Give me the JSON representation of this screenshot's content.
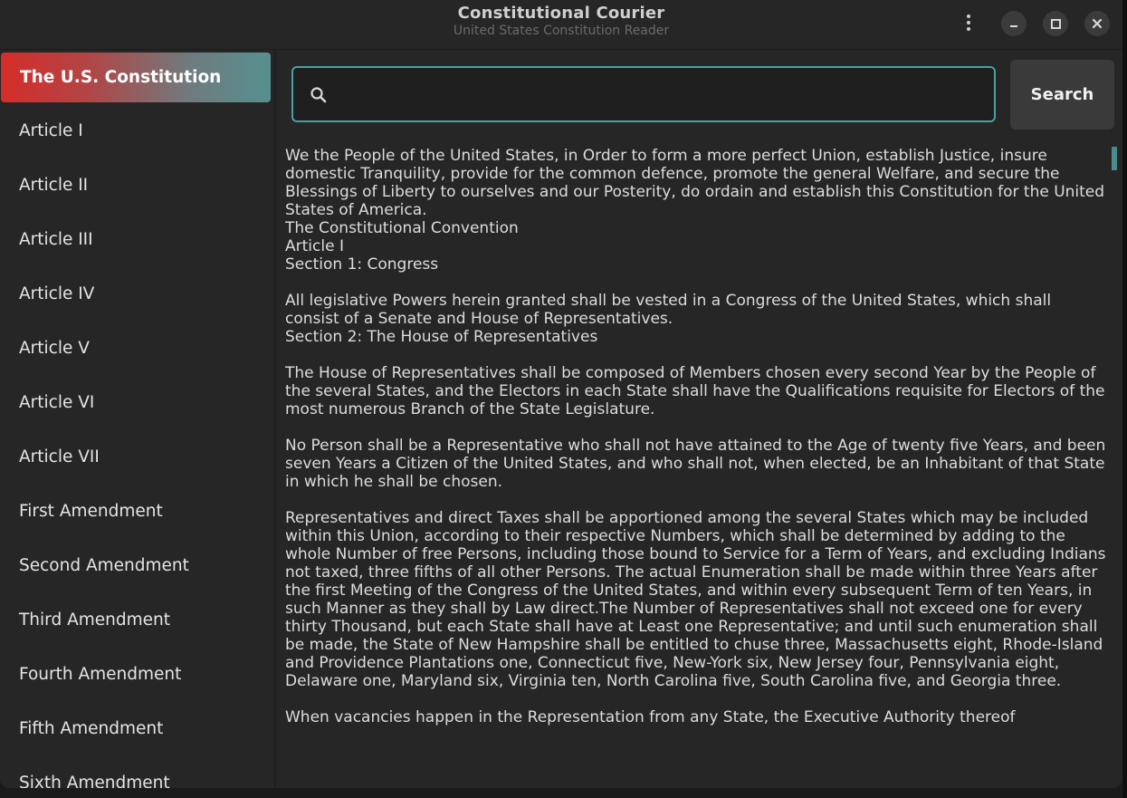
{
  "window": {
    "title": "Constitutional Courier",
    "subtitle": "United States Constitution Reader"
  },
  "titlebar_controls": [
    "menu-icon",
    "minimize-icon",
    "maximize-icon",
    "close-icon"
  ],
  "sidebar": {
    "items": [
      {
        "label": "The U.S. Constitution",
        "active": true
      },
      {
        "label": "Article I"
      },
      {
        "label": "Article II"
      },
      {
        "label": "Article III"
      },
      {
        "label": "Article IV"
      },
      {
        "label": "Article V"
      },
      {
        "label": "Article VI"
      },
      {
        "label": "Article VII"
      },
      {
        "label": "First Amendment"
      },
      {
        "label": "Second Amendment"
      },
      {
        "label": "Third Amendment"
      },
      {
        "label": "Fourth Amendment"
      },
      {
        "label": "Fifth Amendment"
      },
      {
        "label": "Sixth Amendment"
      }
    ]
  },
  "search": {
    "value": "",
    "placeholder": "",
    "button_label": "Search"
  },
  "content": {
    "preamble": "We the People of the United States, in Order to form a more perfect Union, establish Justice, insure domestic Tranquility, provide for the common defence, promote the general Welfare, and secure the Blessings of Liberty to ourselves and our Posterity, do ordain and establish this Constitution for the United States of America.",
    "convention": "The Constitutional Convention",
    "article": "Article I",
    "section1_title": "Section 1: Congress",
    "section1_text": "All legislative Powers herein granted shall be vested in a Congress of the United States, which shall consist of a Senate and House of Representatives.",
    "section2_title": "Section 2: The House of Representatives",
    "section2_p1": "The House of Representatives shall be composed of Members chosen every second Year by the People of the several States, and the Electors in each State shall have the Qualifications requisite for Electors of the most numerous Branch of the State Legislature.",
    "section2_p2": "No Person shall be a Representative who shall not have attained to the Age of twenty five Years, and been seven Years a Citizen of the United States, and who shall not, when elected, be an Inhabitant of that State in which he shall be chosen.",
    "section2_p3": "Representatives and direct Taxes shall be apportioned among the several States which may be included within this Union, according to their respective Numbers, which shall be determined by adding to the whole Number of free Persons, including those bound to Service for a Term of Years, and excluding Indians not taxed, three fifths of all other Persons. The actual Enumeration shall be made within three Years after the first Meeting of the Congress of the United States, and within every subsequent Term of ten Years, in such Manner as they shall by Law direct.The Number of Representatives shall not exceed one for every thirty Thousand, but each State shall have at Least one Representative; and until such enumeration shall be made, the State of New Hampshire shall be entitled to chuse three, Massachusetts eight, Rhode-Island and Providence Plantations one, Connecticut five, New-York six, New Jersey four, Pennsylvania eight, Delaware one, Maryland six, Virginia ten, North Carolina five, South Carolina five, and Georgia three.",
    "section2_p4": "When vacancies happen in the Representation from any State, the Executive Authority thereof"
  },
  "colors": {
    "accent": "#4aa0a0",
    "active_gradient_start": "#d52d28",
    "active_gradient_end": "#56908f",
    "background": "#262626"
  }
}
